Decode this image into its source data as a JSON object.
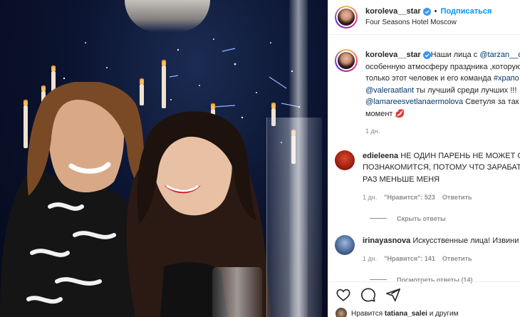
{
  "header": {
    "username": "koroleva__star",
    "separator": "•",
    "follow_label": "Подписаться",
    "location": "Four Seasons Hotel Moscow"
  },
  "caption": {
    "username": "koroleva__star",
    "lines": [
      {
        "text": "Наши лица с ",
        "mention": "@tarzan__o"
      },
      {
        "text": "особенную атмосферу праздника ,которую",
        "mention": ""
      },
      {
        "text": "только этот человек и его команда ",
        "mention": "#храпо"
      },
      {
        "text": " ты лучший среди лучших !!! ",
        "mention": "@valeraatlant",
        "mention_first": true
      },
      {
        "text": " Светуля за так",
        "mention": "@lamareesvetlanaermolova",
        "mention_first": true
      },
      {
        "text": "момент 💋",
        "mention": ""
      }
    ],
    "time": "1 дн."
  },
  "comments": [
    {
      "username": "edieleena",
      "lines": [
        " НЕ ОДИН ПАРЕНЬ НЕ МОЖЕТ С",
        "ПОЗНАКОМИТСЯ, ПОТОМУ ЧТО ЗАРАБАТ",
        "РАЗ МЕНЬШЕ МЕНЯ"
      ],
      "time": "1 дн.",
      "likes": "\"Нравится\": 523",
      "reply": "Ответить",
      "replies_label": "Скрыть ответы"
    },
    {
      "username": "irinayasnova",
      "lines": [
        " Искусственные лица! Извини"
      ],
      "time": "1 дн.",
      "likes": "\"Нравится\": 141",
      "reply": "Ответить",
      "replies_label": "Посмотреть ответы (14)"
    }
  ],
  "footer": {
    "likes_prefix": "Нравится ",
    "likes_user": "tatiana_salei",
    "likes_suffix": " и другим"
  },
  "icons": [
    "heart-icon",
    "comment-icon",
    "share-icon"
  ],
  "colors": {
    "link": "#00376b",
    "follow": "#0095f6",
    "muted": "#8e8e8e",
    "text": "#262626"
  }
}
